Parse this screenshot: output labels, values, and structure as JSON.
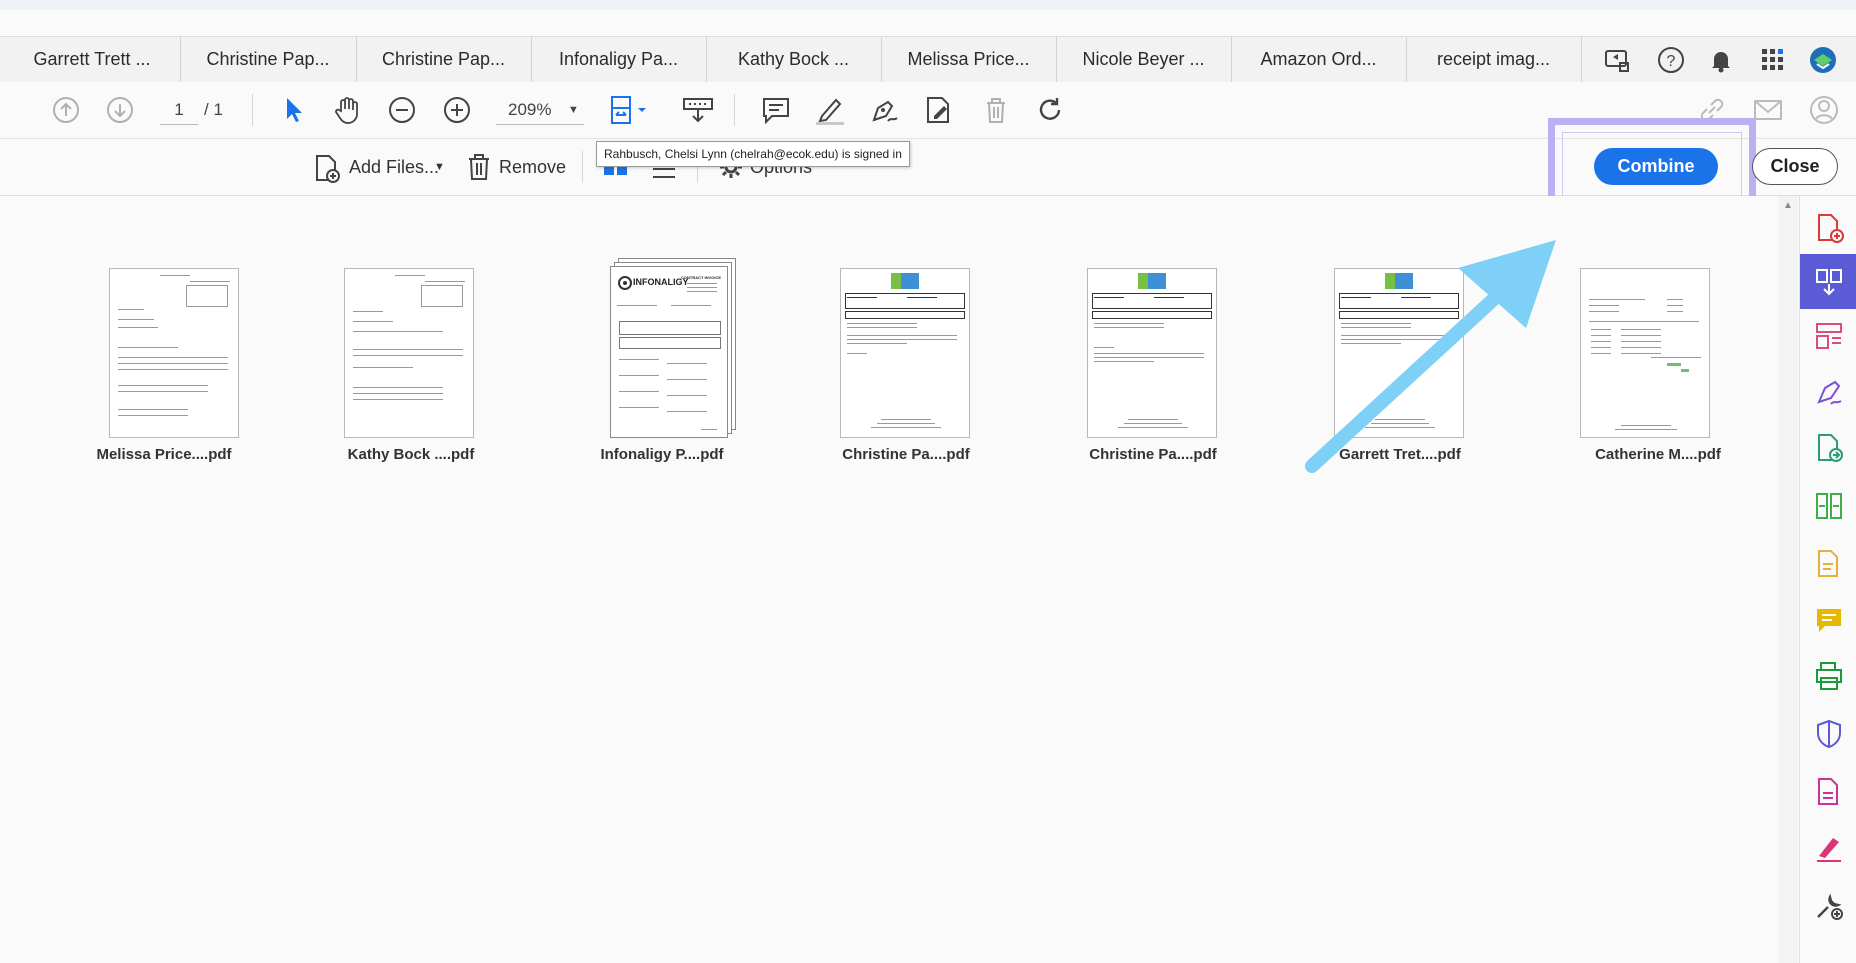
{
  "tabs": [
    {
      "label": "Garrett Trett ..."
    },
    {
      "label": "Christine Pap..."
    },
    {
      "label": "Christine Pap..."
    },
    {
      "label": "Infonaligy Pa..."
    },
    {
      "label": "Kathy Bock ..."
    },
    {
      "label": "Melissa Price..."
    },
    {
      "label": "Nicole Beyer ..."
    },
    {
      "label": "Amazon Ord..."
    },
    {
      "label": "receipt imag..."
    }
  ],
  "tab_icons": [
    "share-screen-icon",
    "help-icon",
    "bell-icon",
    "apps-grid-icon",
    "profile-badge-icon"
  ],
  "toolbar": {
    "page_current": "1",
    "page_total": "/ 1",
    "zoom": "209%",
    "icons": [
      "page-up-icon",
      "page-down-icon",
      "select-arrow-icon",
      "hand-icon",
      "zoom-out-icon",
      "zoom-in-icon",
      "fit-page-icon",
      "scroll-mode-icon",
      "comment-icon",
      "highlight-pen-icon",
      "sign-pen-icon",
      "edit-pdf-icon",
      "trash-icon",
      "rotate-icon",
      "link-icon",
      "mail-icon",
      "account-icon"
    ]
  },
  "combine_bar": {
    "add_files_label": "Add Files...",
    "remove_label": "Remove",
    "options_label": "Options",
    "combine_label": "Combine",
    "close_label": "Close"
  },
  "tooltip": "Rahbusch, Chelsi Lynn (chelrah@ecok.edu) is signed in",
  "files": [
    {
      "name": "Melissa Price....pdf",
      "kind": "form"
    },
    {
      "name": "Kathy Bock ....pdf",
      "kind": "form"
    },
    {
      "name": "Infonaligy P....pdf",
      "kind": "invoice",
      "logo_text": "INFONALIGY",
      "heading": "CONTRACT INVOICE"
    },
    {
      "name": "Christine Pa....pdf",
      "kind": "hotel"
    },
    {
      "name": "Christine Pa....pdf",
      "kind": "hotel"
    },
    {
      "name": "Garrett Tret....pdf",
      "kind": "hotel"
    },
    {
      "name": "Catherine M....pdf",
      "kind": "receipt"
    }
  ],
  "colors": {
    "accent": "#1a73e8",
    "highlight": "#b9b1f2",
    "arrow": "#7ed0f6",
    "sidebar_active": "#5b5bd6"
  },
  "sidebar_icons": [
    "create-pdf-icon",
    "combine-files-icon",
    "organize-pages-icon",
    "fill-sign-icon",
    "export-pdf-icon",
    "compress-icon",
    "edit-text-icon",
    "comment-tool-icon",
    "print-production-icon",
    "protect-icon",
    "pdf-standards-icon",
    "sign-tool-icon",
    "more-tools-icon"
  ]
}
